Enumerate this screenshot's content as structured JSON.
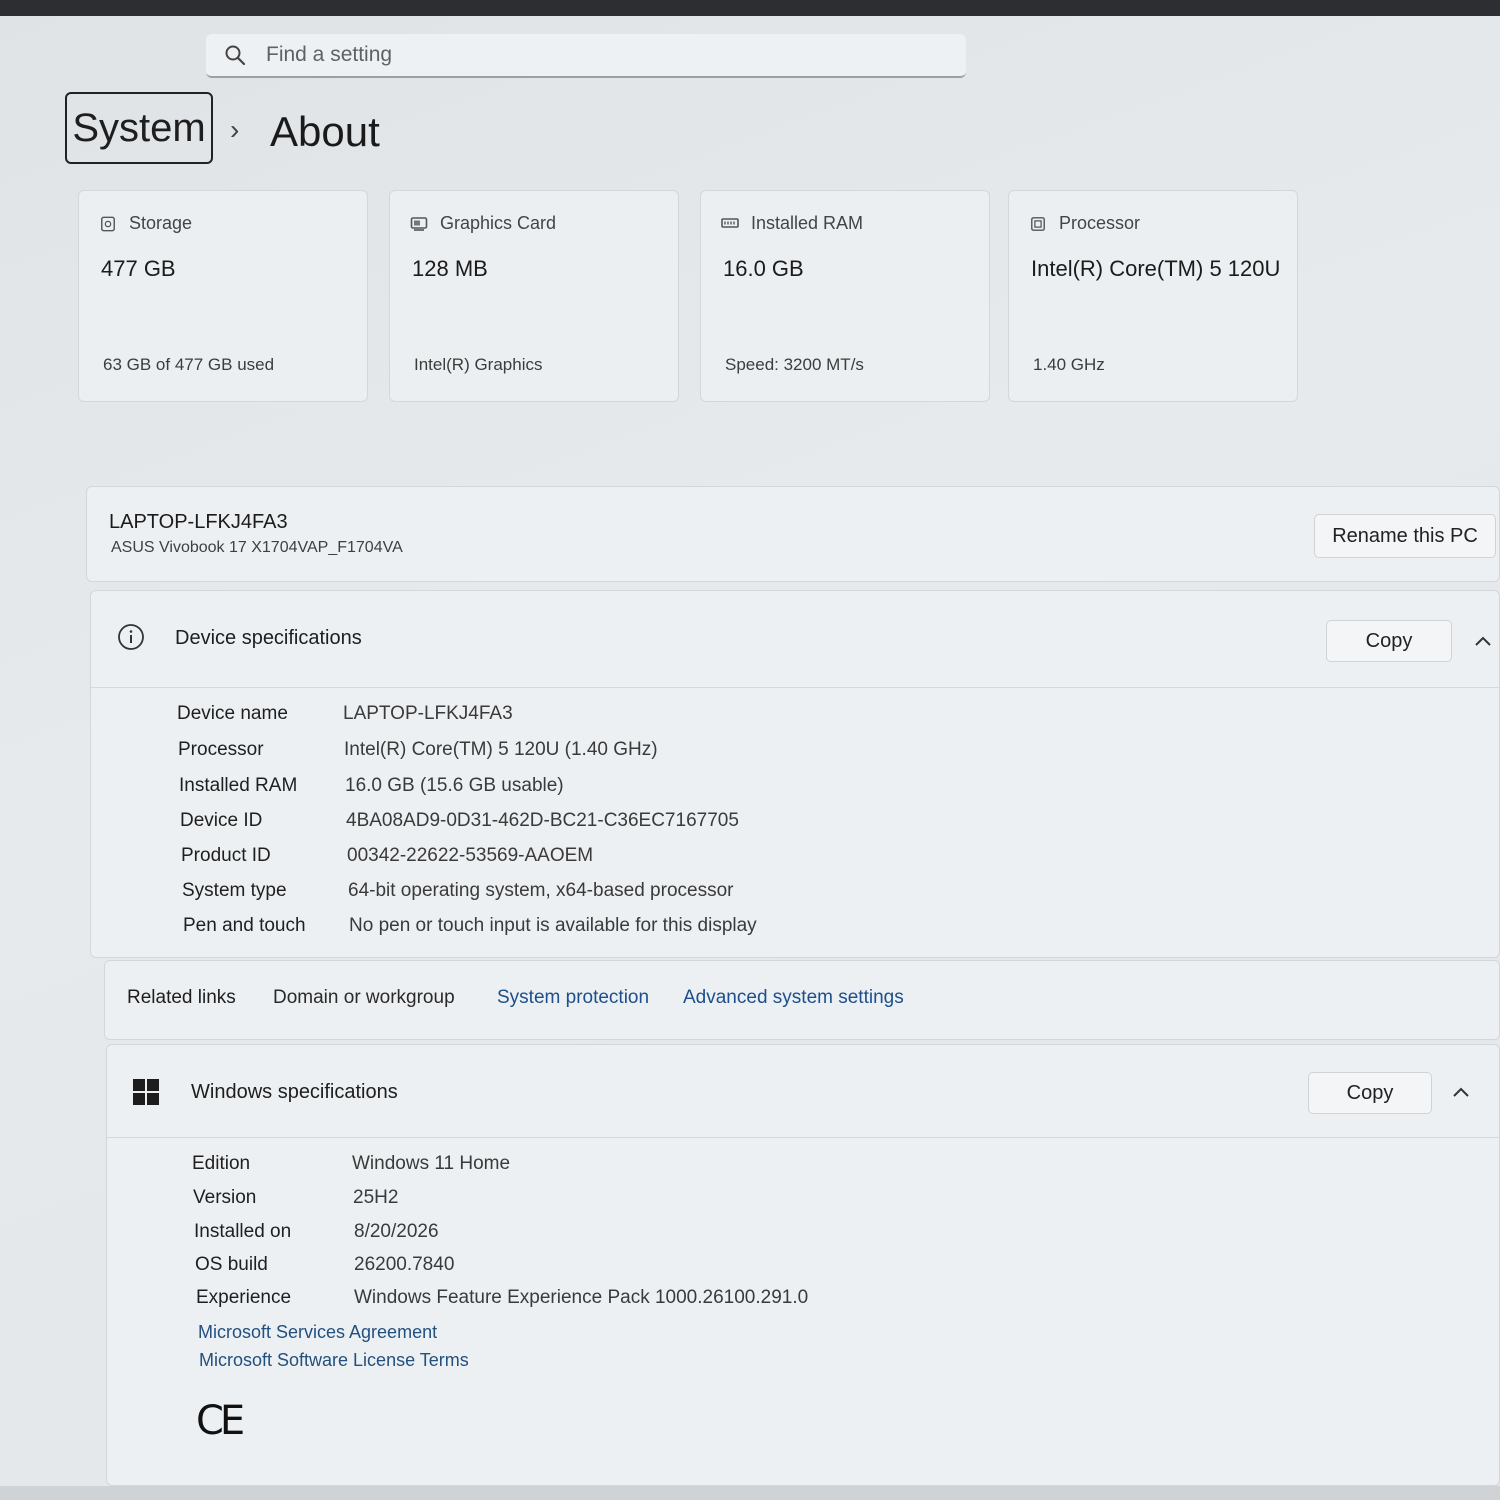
{
  "search": {
    "placeholder": "Find a setting"
  },
  "breadcrumb": {
    "root": "System",
    "separator": "›",
    "current": "About"
  },
  "tiles": [
    {
      "name": "storage",
      "icon": "storage-icon",
      "label": "Storage",
      "value": "477 GB",
      "sub": "63 GB of 477 GB used"
    },
    {
      "name": "graphics-card",
      "icon": "graphics-card-icon",
      "label": "Graphics Card",
      "value": "128 MB",
      "sub": "Intel(R) Graphics"
    },
    {
      "name": "installed-ram",
      "icon": "ram-icon",
      "label": "Installed RAM",
      "value": "16.0 GB",
      "sub": "Speed: 3200 MT/s"
    },
    {
      "name": "processor",
      "icon": "processor-icon",
      "label": "Processor",
      "value": "Intel(R) Core(TM) 5 120U",
      "sub": "1.40 GHz"
    }
  ],
  "pc": {
    "name": "LAPTOP-LFKJ4FA3",
    "model": "ASUS Vivobook 17 X1704VAP_F1704VA",
    "rename_label": "Rename this PC"
  },
  "device_specs": {
    "title": "Device specifications",
    "copy_label": "Copy",
    "rows": [
      {
        "key": "Device name",
        "value": "LAPTOP-LFKJ4FA3"
      },
      {
        "key": "Processor",
        "value": "Intel(R) Core(TM) 5 120U (1.40 GHz)"
      },
      {
        "key": "Installed RAM",
        "value": "16.0 GB (15.6 GB usable)"
      },
      {
        "key": "Device ID",
        "value": "4BA08AD9-0D31-462D-BC21-C36EC7167705"
      },
      {
        "key": "Product ID",
        "value": "00342-22622-53569-AAOEM"
      },
      {
        "key": "System type",
        "value": "64-bit operating system, x64-based processor"
      },
      {
        "key": "Pen and touch",
        "value": "No pen or touch input is available for this display"
      }
    ]
  },
  "related_links": {
    "label": "Related links",
    "links": [
      "Domain or workgroup",
      "System protection",
      "Advanced system settings"
    ]
  },
  "windows_specs": {
    "title": "Windows specifications",
    "copy_label": "Copy",
    "rows": [
      {
        "key": "Edition",
        "value": "Windows 11 Home"
      },
      {
        "key": "Version",
        "value": "25H2"
      },
      {
        "key": "Installed on",
        "value": "8/20/2026"
      },
      {
        "key": "OS build",
        "value": "26200.7840"
      },
      {
        "key": "Experience",
        "value": "Windows Feature Experience Pack 1000.26100.291.0"
      }
    ],
    "links": [
      "Microsoft Services Agreement",
      "Microsoft Software License Terms"
    ],
    "mark": "CE"
  }
}
